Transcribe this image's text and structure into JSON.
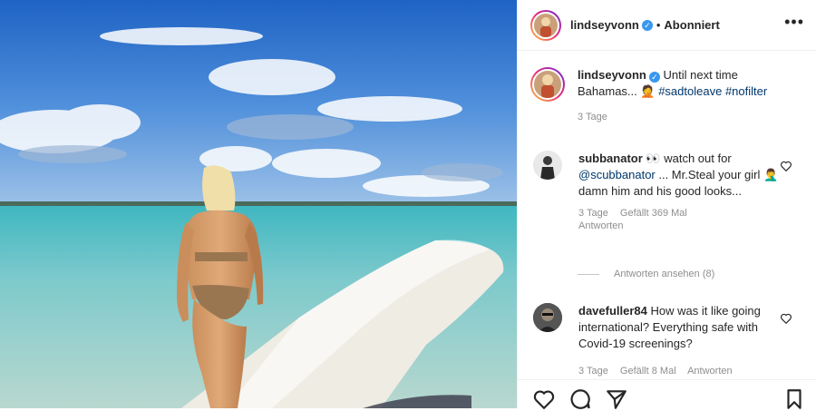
{
  "post": {
    "author": "lindseyvonn",
    "follow_status": "Abonniert",
    "separator": "•",
    "more_label": "•••"
  },
  "caption": {
    "author": "lindseyvonn",
    "text": "Until next time Bahamas... ",
    "emoji": "🤦",
    "hashtag1": "#sadtoleave",
    "hashtag2": "#nofilter",
    "time": "3 Tage"
  },
  "comments": [
    {
      "author": "subbanator",
      "emoji": "👀",
      "text_a": " watch out for ",
      "mention": "@scubbanator",
      "text_b": " ... Mr.Steal your girl ",
      "emoji2": "🤦‍♂️",
      "text_c": " damn him and his good looks...",
      "time": "3 Tage",
      "likes": "Gefällt 369 Mal",
      "reply": "Antworten"
    },
    {
      "author": "davefuller84",
      "text": "How was it like going international? Everything safe with Covid-19 screenings?",
      "time": "3 Tage",
      "likes": "Gefällt 8 Mal",
      "reply": "Antworten"
    }
  ],
  "view_replies": "Antworten ansehen (8)",
  "icons": {
    "verified": "✓"
  },
  "colors": {
    "link": "#00376b",
    "meta": "#8e8e8e",
    "verified": "#3897f0"
  }
}
